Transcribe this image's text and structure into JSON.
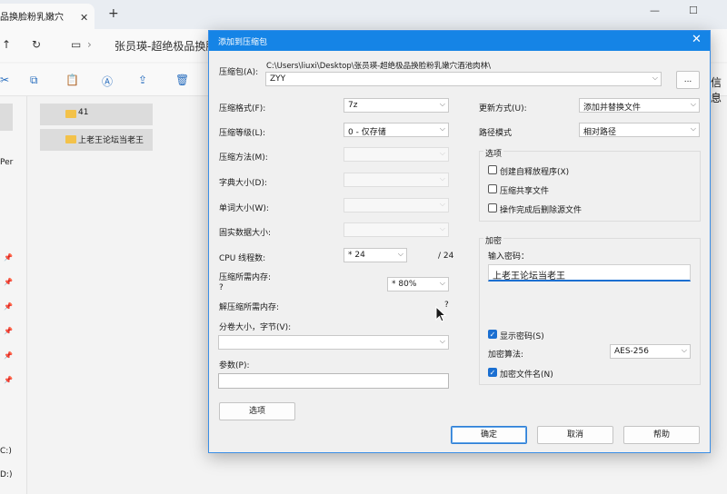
{
  "explorer": {
    "tab_title": "品换脸粉乳嫩穴",
    "tab_close": "✕",
    "new_tab": "+",
    "window_controls": [
      "—",
      "☐"
    ],
    "address_text": "张员瑛-超绝极品换脸",
    "right_info": "信息",
    "left_texts": [
      "Per",
      "C:)",
      "D:)"
    ],
    "files": [
      "41",
      "上老王论坛当老王"
    ]
  },
  "dialog": {
    "title": "添加到压缩包",
    "close": "✕",
    "archive": {
      "label": "压缩包(A):",
      "path": "C:\\Users\\liuxi\\Desktop\\张员瑛-超绝极品换脸粉乳嫩穴酒池肉林\\",
      "name": "ZYY",
      "browse": "..."
    },
    "left": {
      "format": {
        "label": "压缩格式(F):",
        "value": "7z"
      },
      "level": {
        "label": "压缩等级(L):",
        "value": "0 - 仅存储"
      },
      "method": {
        "label": "压缩方法(M):"
      },
      "dict": {
        "label": "字典大小(D):"
      },
      "word": {
        "label": "单词大小(W):"
      },
      "solid": {
        "label": "固实数据大小:"
      },
      "cpu": {
        "label": "CPU 线程数:",
        "value": "* 24",
        "max": "/ 24"
      },
      "mem_comp": {
        "label": "压缩所需内存:",
        "sub": "?",
        "value": "* 80%"
      },
      "mem_decomp": {
        "label": "解压缩所需内存:",
        "value": "?"
      },
      "split": {
        "label": "分卷大小，字节(V):"
      },
      "params": {
        "label": "参数(P):"
      },
      "options_btn": "选项"
    },
    "right": {
      "update": {
        "label": "更新方式(U):",
        "value": "添加并替换文件"
      },
      "path": {
        "label": "路径模式",
        "value": "相对路径"
      },
      "options_group": "选项",
      "options": [
        {
          "label": "创建自释放程序(X)",
          "checked": false
        },
        {
          "label": "压缩共享文件",
          "checked": false
        },
        {
          "label": "操作完成后删除源文件",
          "checked": false
        }
      ],
      "encrypt_group": "加密",
      "password_label": "输入密码：",
      "password_value": "上老王论坛当老王",
      "show_password": {
        "label": "显示密码(S)",
        "checked": true
      },
      "algo": {
        "label": "加密算法:",
        "value": "AES-256"
      },
      "encrypt_names": {
        "label": "加密文件名(N)",
        "checked": true
      }
    },
    "buttons": {
      "ok": "确定",
      "cancel": "取消",
      "help": "帮助"
    }
  }
}
